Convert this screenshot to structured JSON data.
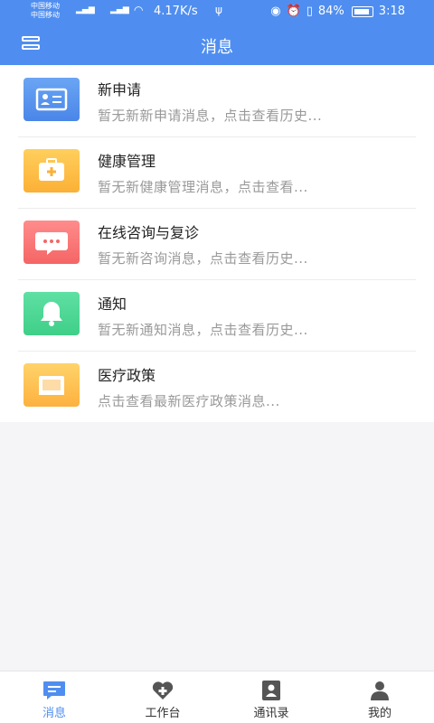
{
  "status": {
    "carrier1": "中国移动",
    "carrier2": "中国移动",
    "net_speed": "4.17K/s",
    "battery": "84%",
    "time": "3:18"
  },
  "nav": {
    "title": "消息"
  },
  "items": [
    {
      "title": "新申请",
      "desc": "暂无新新申请消息，点击查看历史...",
      "color": "#4a86e8",
      "icon": "id-card-icon"
    },
    {
      "title": "健康管理",
      "desc": "暂无新健康管理消息，点击查看...",
      "color": "#fcb036",
      "icon": "medical-kit-icon"
    },
    {
      "title": "在线咨询与复诊",
      "desc": "暂无新咨询消息，点击查看历史...",
      "color": "#f56565",
      "icon": "chat-bubble-icon"
    },
    {
      "title": "通知",
      "desc": "暂无新通知消息，点击查看历史...",
      "color": "#3fcf88",
      "icon": "bell-icon"
    },
    {
      "title": "医疗政策",
      "desc": "点击查看最新医疗政策消息...",
      "color": "#fdb13f",
      "icon": "book-icon"
    }
  ],
  "tabs": [
    {
      "label": "消息",
      "icon": "message-icon",
      "active": true
    },
    {
      "label": "工作台",
      "icon": "heart-plus-icon",
      "active": false
    },
    {
      "label": "通讯录",
      "icon": "contacts-icon",
      "active": false
    },
    {
      "label": "我的",
      "icon": "person-icon",
      "active": false
    }
  ],
  "colors": {
    "primary": "#4f8ef0",
    "inactive_tab": "#555555"
  }
}
